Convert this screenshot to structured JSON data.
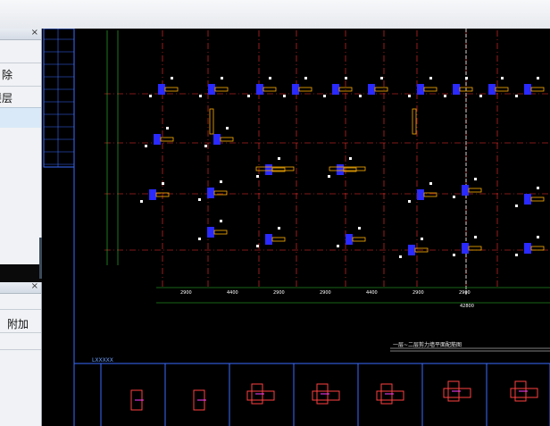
{
  "panel_top": {
    "close_glyph": "×",
    "item_delete": "除",
    "item_layer": "楼层"
  },
  "panel_bottom": {
    "close_glyph": "×",
    "col_attach": "附加"
  },
  "drawing": {
    "plan_title": "一层~二层剪力墙平面配筋图",
    "legend_label": "LXXXXX",
    "dim_row": [
      "2900",
      "4400",
      "2900",
      "2900",
      "4400",
      "2900",
      "2900"
    ],
    "total_dim": "42800",
    "colors": {
      "background": "#000000",
      "grid": "#ff3030",
      "wall": "#2a2aff",
      "dim": "#ffffff",
      "frame": "#3a6bff",
      "detail": "#ff4040"
    }
  }
}
